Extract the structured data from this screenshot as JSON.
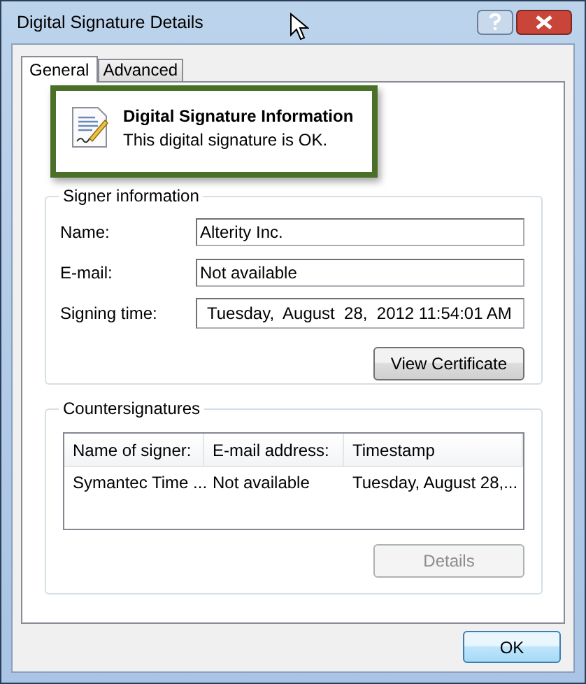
{
  "window": {
    "title": "Digital Signature Details"
  },
  "tabs": [
    {
      "label": "General",
      "selected": true
    },
    {
      "label": "Advanced",
      "selected": false
    }
  ],
  "info": {
    "title": "Digital Signature Information",
    "message": "This digital signature is OK."
  },
  "signer_information": {
    "legend": "Signer information",
    "fields": [
      {
        "label": "Name:",
        "value": "Alterity Inc."
      },
      {
        "label": "E-mail:",
        "value": "Not available"
      },
      {
        "label": "Signing time:",
        "value": "Tuesday,  August  28,  2012 11:54:01 AM"
      }
    ],
    "button": {
      "label": "View Certificate",
      "disabled": false
    }
  },
  "countersignatures": {
    "legend": "Countersignatures",
    "columns": [
      "Name of signer:",
      "E-mail address:",
      "Timestamp"
    ],
    "rows": [
      [
        "Symantec Time ...",
        "Not available",
        "Tuesday, August 28,..."
      ]
    ],
    "button": {
      "label": "Details",
      "disabled": true
    }
  },
  "ok_button": {
    "label": "OK",
    "disabled": false
  }
}
